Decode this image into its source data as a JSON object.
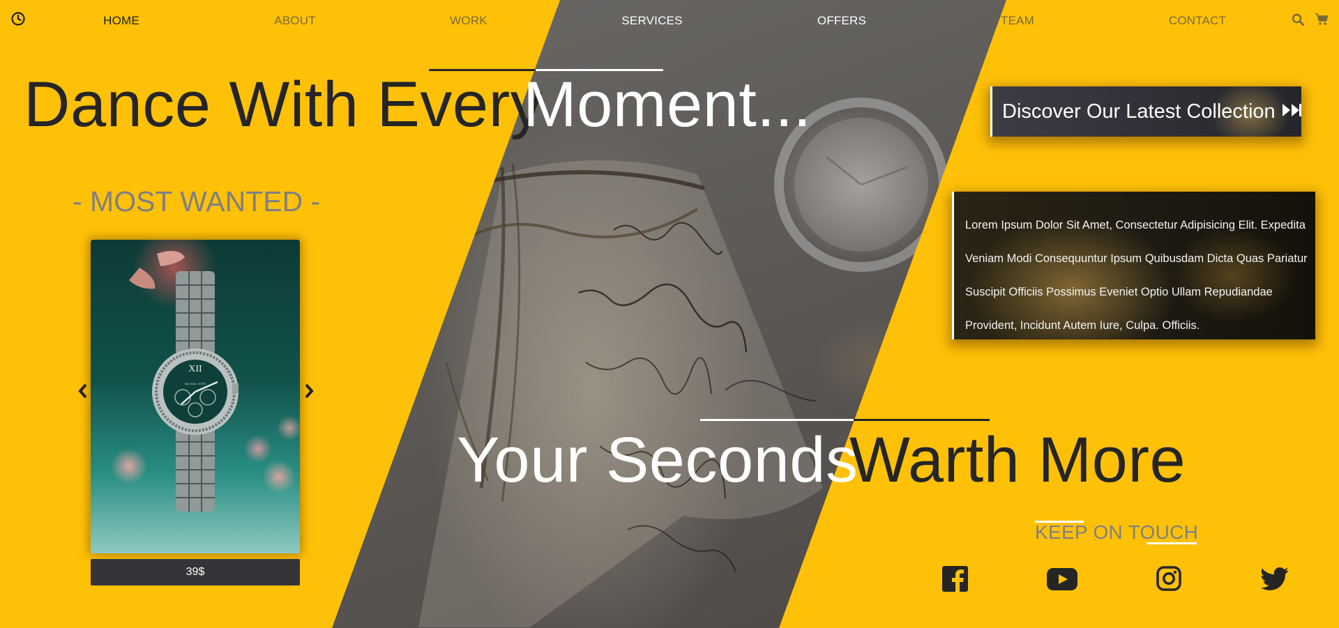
{
  "nav": {
    "items": [
      {
        "label": "HOME"
      },
      {
        "label": "ABOUT"
      },
      {
        "label": "WORK"
      },
      {
        "label": "SERVICES"
      },
      {
        "label": "OFFERS"
      },
      {
        "label": "TEAM"
      },
      {
        "label": "CONTACT"
      }
    ],
    "active": "HOME"
  },
  "hero": {
    "headline_dark": "Dance With Every",
    "headline_light": "Moment..."
  },
  "most_wanted": {
    "title": "- MOST WANTED -",
    "product_watch_text": "MICHAEL KORS",
    "price": "39$"
  },
  "discover": {
    "label": "Discover Our Latest Collection"
  },
  "lorem": {
    "lines": [
      "Lorem Ipsum Dolor Sit Amet, Consectetur Adipisicing Elit. Expedita",
      "Veniam Modi Consequuntur Ipsum Quibusdam Dicta Quas Pariatur",
      "Suscipit Officiis Possimus Eveniet Optio Ullam Repudiandae",
      "Provident, Incidunt Autem Iure, Culpa. Officiis."
    ]
  },
  "tagline": {
    "light": "Your Seconds",
    "dark": "Warth More"
  },
  "keep_in_touch": {
    "label": "KEEP ON TOUCH"
  },
  "colors": {
    "background": "#ffc107",
    "dark_text": "#252525",
    "muted_text": "#7f7f84",
    "price_bg": "#353539"
  },
  "icons": {
    "left": "clock-icon",
    "right": [
      "search-icon",
      "cart-icon"
    ],
    "social": [
      "facebook-icon",
      "youtube-icon",
      "instagram-icon",
      "twitter-icon"
    ]
  }
}
